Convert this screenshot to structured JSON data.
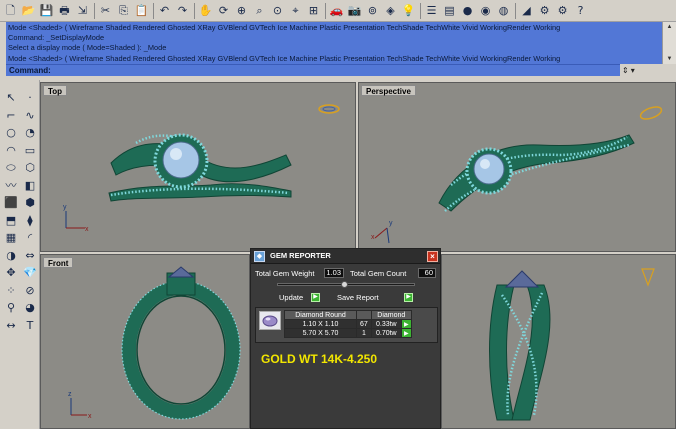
{
  "toolbar": {
    "icons": [
      "new-file-icon",
      "open-folder-icon",
      "save-icon",
      "print-icon",
      "import-icon",
      "cut-icon",
      "copy-icon",
      "paste-icon",
      "undo-icon",
      "redo-icon",
      "pan-hand-icon",
      "rotate-view-icon",
      "zoom-icon",
      "zoom-window-icon",
      "zoom-extents-icon",
      "zoom-selected-icon",
      "four-viewports-icon",
      "car-icon",
      "camera-icon",
      "osnap-icon",
      "wireframe-icon",
      "lightbulb-icon",
      "properties-icon",
      "layer-icon",
      "render-sphere-icon",
      "material-sphere-icon",
      "texture-sphere-icon",
      "dimension-icon",
      "settings-gear-icon",
      "options-icon",
      "help-icon"
    ],
    "glyphs": [
      "🗋",
      "📂",
      "💾",
      "🖶",
      "⇲",
      "✂",
      "⎘",
      "📋",
      "↶",
      "↷",
      "✋",
      "⟳",
      "⊕",
      "⌕",
      "⊙",
      "⌖",
      "⊞",
      "🚗",
      "📷",
      "⊚",
      "◈",
      "💡",
      "☰",
      "▤",
      "●",
      "◉",
      "◍",
      "◢",
      "⚙",
      "⚙",
      "?"
    ]
  },
  "history": {
    "lines": [
      "Mode <Shaded> ( Wireframe  Shaded  Rendered  Ghosted  XRay  GVBlend  GVTech  Ice  Machine  Plastic  Presentation  TechShade  TechWhite  Vivid  WorkingRender  Working",
      "Command: _SetDisplayMode",
      "Select a display mode ( Mode=Shaded ): _Mode",
      "Mode <Shaded> ( Wireframe  Shaded  Rendered  Ghosted  XRay  GVBlend  GVTech  Ice  Machine  Plastic  Presentation  TechShade  TechWhite  Vivid  WorkingRender  Working"
    ]
  },
  "command": {
    "label": "Command:"
  },
  "palette": {
    "icons": [
      "select-arrow-icon",
      "point-icon",
      "polyline-icon",
      "curve-icon",
      "circle-icon",
      "sphere-icon",
      "arc-icon",
      "rectangle-icon",
      "ellipse-icon",
      "polygon-icon",
      "freeform-curve-icon",
      "surface-icon",
      "box-solid-icon",
      "cylinder-icon",
      "extrude-icon",
      "loft-icon",
      "mesh-icon",
      "fillet-icon",
      "boolean-icon",
      "transform-icon",
      "move-icon",
      "gem-icon",
      "array-icon",
      "ring-icon",
      "analyze-icon",
      "render-icon",
      "dimension-icon",
      "text-icon"
    ],
    "glyphs": [
      "↖",
      "·",
      "⌐",
      "∿",
      "○",
      "◔",
      "◠",
      "▭",
      "⬭",
      "⬡",
      "〰",
      "◧",
      "⬛",
      "⬢",
      "⬒",
      "⧫",
      "▦",
      "◜",
      "◑",
      "⇔",
      "✥",
      "💎",
      "⁘",
      "⊘",
      "⚲",
      "◕",
      "↔",
      "T"
    ]
  },
  "viewports": {
    "top": {
      "title": "Top"
    },
    "perspective": {
      "title": "Perspective"
    },
    "front": {
      "title": "Front"
    },
    "right": {
      "title": ""
    }
  },
  "colors": {
    "ring_green": "#1e6b55",
    "ring_dark": "#104535",
    "gem_blue": "#a6c6e6",
    "pave_cyan": "#7fd8dc",
    "viewport_bg": "#8c8b86"
  },
  "gem_reporter": {
    "title": "GEM REPORTER",
    "total_weight_label": "Total Gem Weight",
    "total_weight_value": "1.03",
    "total_count_label": "Total Gem Count",
    "total_count_value": "60",
    "update_label": "Update",
    "save_report_label": "Save Report",
    "table": {
      "headers": [
        "Diamond Round",
        "",
        "Diamond"
      ],
      "rows": [
        {
          "size": "1.10 X 1.10",
          "count": "67",
          "weight": "0.33tw"
        },
        {
          "size": "5.70 X 5.70",
          "count": "1",
          "weight": "0.70tw"
        }
      ]
    },
    "gold_weight": "GOLD WT 14K-4.250"
  }
}
